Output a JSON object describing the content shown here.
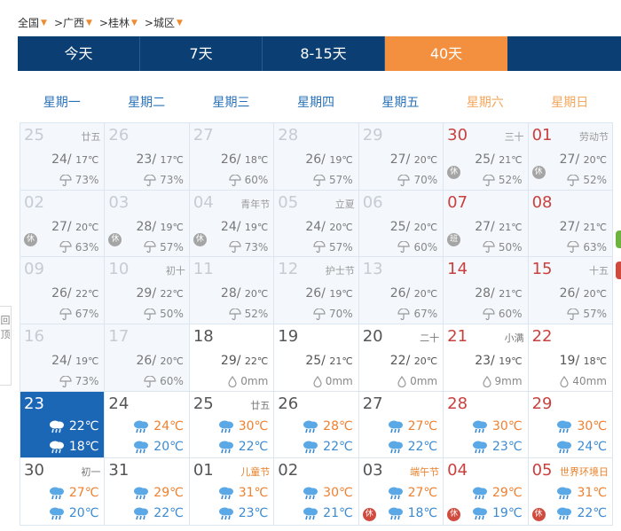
{
  "breadcrumb": [
    {
      "label": "全国"
    },
    {
      "label": ">广西"
    },
    {
      "label": ">桂林"
    },
    {
      "label": ">城区"
    }
  ],
  "tabs": [
    {
      "label": "今天",
      "active": false
    },
    {
      "label": "7天",
      "active": false
    },
    {
      "label": "8-15天",
      "active": false
    },
    {
      "label": "40天",
      "active": true
    }
  ],
  "weekdays": [
    "星期一",
    "星期二",
    "星期三",
    "星期四",
    "星期五",
    "星期六",
    "星期日"
  ],
  "side_left_text": "回\n​顶",
  "colors": {
    "nav_bg": "#0b3e73",
    "tab_active": "#f3903f",
    "today_bg": "#1c66b6",
    "holiday_red": "#d04a3e"
  },
  "days": [
    {
      "day": "25",
      "note": "廿五",
      "hi": "24",
      "lo": "17℃",
      "prec": "73%",
      "prec_type": "rate",
      "state": "past"
    },
    {
      "day": "26",
      "note": "",
      "hi": "23",
      "lo": "17℃",
      "prec": "73%",
      "prec_type": "rate",
      "state": "past"
    },
    {
      "day": "27",
      "note": "",
      "hi": "26",
      "lo": "18℃",
      "prec": "60%",
      "prec_type": "rate",
      "state": "past"
    },
    {
      "day": "28",
      "note": "",
      "hi": "26",
      "lo": "19℃",
      "prec": "57%",
      "prec_type": "rate",
      "state": "past"
    },
    {
      "day": "29",
      "note": "",
      "hi": "27",
      "lo": "20℃",
      "prec": "70%",
      "prec_type": "rate",
      "state": "past"
    },
    {
      "day": "30",
      "note": "三十",
      "hi": "25",
      "lo": "21℃",
      "prec": "52%",
      "prec_type": "rate",
      "state": "past",
      "red": true,
      "badge": "休"
    },
    {
      "day": "01",
      "note": "劳动节",
      "hi": "27",
      "lo": "20℃",
      "prec": "52%",
      "prec_type": "rate",
      "state": "past",
      "red": true,
      "badge": "休"
    },
    {
      "day": "02",
      "note": "",
      "hi": "27",
      "lo": "20℃",
      "prec": "63%",
      "prec_type": "rate",
      "state": "past",
      "badge": "休"
    },
    {
      "day": "03",
      "note": "",
      "hi": "28",
      "lo": "19℃",
      "prec": "57%",
      "prec_type": "rate",
      "state": "past",
      "badge": "休"
    },
    {
      "day": "04",
      "note": "青年节",
      "hi": "24",
      "lo": "19℃",
      "prec": "73%",
      "prec_type": "rate",
      "state": "past",
      "badge": "休"
    },
    {
      "day": "05",
      "note": "立夏",
      "hi": "24",
      "lo": "20℃",
      "prec": "57%",
      "prec_type": "rate",
      "state": "past"
    },
    {
      "day": "06",
      "note": "",
      "hi": "25",
      "lo": "20℃",
      "prec": "60%",
      "prec_type": "rate",
      "state": "past"
    },
    {
      "day": "07",
      "note": "",
      "hi": "27",
      "lo": "21℃",
      "prec": "50%",
      "prec_type": "rate",
      "state": "past",
      "red": true,
      "badge": "班"
    },
    {
      "day": "08",
      "note": "",
      "hi": "27",
      "lo": "21℃",
      "prec": "63%",
      "prec_type": "rate",
      "state": "past",
      "red": true
    },
    {
      "day": "09",
      "note": "",
      "hi": "26",
      "lo": "22℃",
      "prec": "67%",
      "prec_type": "rate",
      "state": "past"
    },
    {
      "day": "10",
      "note": "初十",
      "hi": "29",
      "lo": "22℃",
      "prec": "50%",
      "prec_type": "rate",
      "state": "past"
    },
    {
      "day": "11",
      "note": "",
      "hi": "28",
      "lo": "20℃",
      "prec": "52%",
      "prec_type": "rate",
      "state": "past"
    },
    {
      "day": "12",
      "note": "护士节",
      "hi": "26",
      "lo": "19℃",
      "prec": "70%",
      "prec_type": "rate",
      "state": "past"
    },
    {
      "day": "13",
      "note": "",
      "hi": "26",
      "lo": "20℃",
      "prec": "67%",
      "prec_type": "rate",
      "state": "past"
    },
    {
      "day": "14",
      "note": "",
      "hi": "28",
      "lo": "21℃",
      "prec": "60%",
      "prec_type": "rate",
      "state": "past",
      "red": true
    },
    {
      "day": "15",
      "note": "十五",
      "hi": "26",
      "lo": "20℃",
      "prec": "57%",
      "prec_type": "rate",
      "state": "past",
      "red": true
    },
    {
      "day": "16",
      "note": "",
      "hi": "24",
      "lo": "19℃",
      "prec": "73%",
      "prec_type": "rate",
      "state": "past"
    },
    {
      "day": "17",
      "note": "",
      "hi": "26",
      "lo": "20℃",
      "prec": "60%",
      "prec_type": "rate",
      "state": "past"
    },
    {
      "day": "18",
      "note": "",
      "hi": "29",
      "lo": "22℃",
      "prec": "0mm",
      "prec_type": "amount",
      "state": "recent"
    },
    {
      "day": "19",
      "note": "",
      "hi": "25",
      "lo": "21℃",
      "prec": "0mm",
      "prec_type": "amount",
      "state": "recent"
    },
    {
      "day": "20",
      "note": "二十",
      "hi": "22",
      "lo": "20℃",
      "prec": "0mm",
      "prec_type": "amount",
      "state": "recent"
    },
    {
      "day": "21",
      "note": "小满",
      "hi": "23",
      "lo": "19℃",
      "prec": "9mm",
      "prec_type": "amount",
      "state": "recent",
      "red": true
    },
    {
      "day": "22",
      "note": "",
      "hi": "19",
      "lo": "18℃",
      "prec": "40mm",
      "prec_type": "amount",
      "state": "recent",
      "red": true
    },
    {
      "day": "23",
      "note": "",
      "fhi": "22℃",
      "flo": "18℃",
      "state": "today"
    },
    {
      "day": "24",
      "note": "",
      "fhi": "24℃",
      "flo": "20℃",
      "state": "future"
    },
    {
      "day": "25",
      "note": "廿五",
      "fhi": "30℃",
      "flo": "22℃",
      "state": "future"
    },
    {
      "day": "26",
      "note": "",
      "fhi": "28℃",
      "flo": "22℃",
      "state": "future"
    },
    {
      "day": "27",
      "note": "",
      "fhi": "27℃",
      "flo": "22℃",
      "state": "future"
    },
    {
      "day": "28",
      "note": "",
      "fhi": "30℃",
      "flo": "23℃",
      "state": "future",
      "red": true
    },
    {
      "day": "29",
      "note": "",
      "fhi": "30℃",
      "flo": "24℃",
      "state": "future",
      "red": true
    },
    {
      "day": "30",
      "note": "初一",
      "fhi": "27℃",
      "flo": "20℃",
      "state": "future"
    },
    {
      "day": "31",
      "note": "",
      "fhi": "29℃",
      "flo": "22℃",
      "state": "future"
    },
    {
      "day": "01",
      "note": "儿童节",
      "note_hl": true,
      "fhi": "31℃",
      "flo": "23℃",
      "state": "future"
    },
    {
      "day": "02",
      "note": "",
      "fhi": "30℃",
      "flo": "21℃",
      "state": "future"
    },
    {
      "day": "03",
      "note": "端午节",
      "note_hl": true,
      "fhi": "27℃",
      "flo": "18℃",
      "state": "future",
      "badge": "休"
    },
    {
      "day": "04",
      "note": "",
      "fhi": "29℃",
      "flo": "19℃",
      "state": "future",
      "red": true,
      "badge": "休"
    },
    {
      "day": "05",
      "note": "世界环境日",
      "note_hl": true,
      "fhi": "31℃",
      "flo": "22℃",
      "state": "future",
      "red": true,
      "badge": "休"
    }
  ]
}
